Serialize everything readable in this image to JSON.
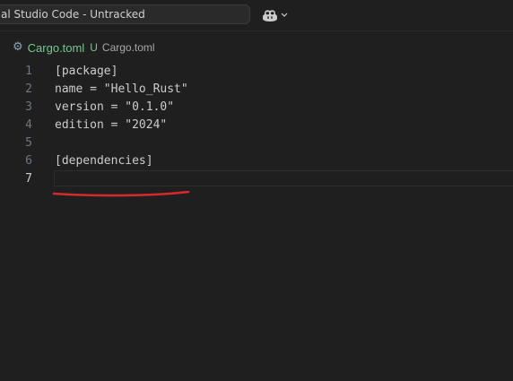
{
  "titlebar": {
    "search_text": "al Studio Code - Untracked",
    "copilot_icon": "copilot-icon",
    "copilot_menu_icon": "chevron-down-icon"
  },
  "breadcrumb": {
    "settings_icon": "gear-icon",
    "file_name": "Cargo.toml",
    "git_status": "U",
    "path": "Cargo.toml"
  },
  "editor": {
    "active_line": 7,
    "lines": [
      {
        "number": "1",
        "text": "[package]"
      },
      {
        "number": "2",
        "text": "name = \"Hello_Rust\""
      },
      {
        "number": "3",
        "text": "version = \"0.1.0\""
      },
      {
        "number": "4",
        "text": "edition = \"2024\""
      },
      {
        "number": "5",
        "text": ""
      },
      {
        "number": "6",
        "text": "[dependencies]"
      },
      {
        "number": "7",
        "text": ""
      }
    ]
  },
  "annotation": {
    "target_line": 4,
    "color": "#d42a2a"
  },
  "colors": {
    "background": "#1f1f1f",
    "git_untracked": "#73c991",
    "text": "#cccccc",
    "line_number": "#6e7681"
  }
}
